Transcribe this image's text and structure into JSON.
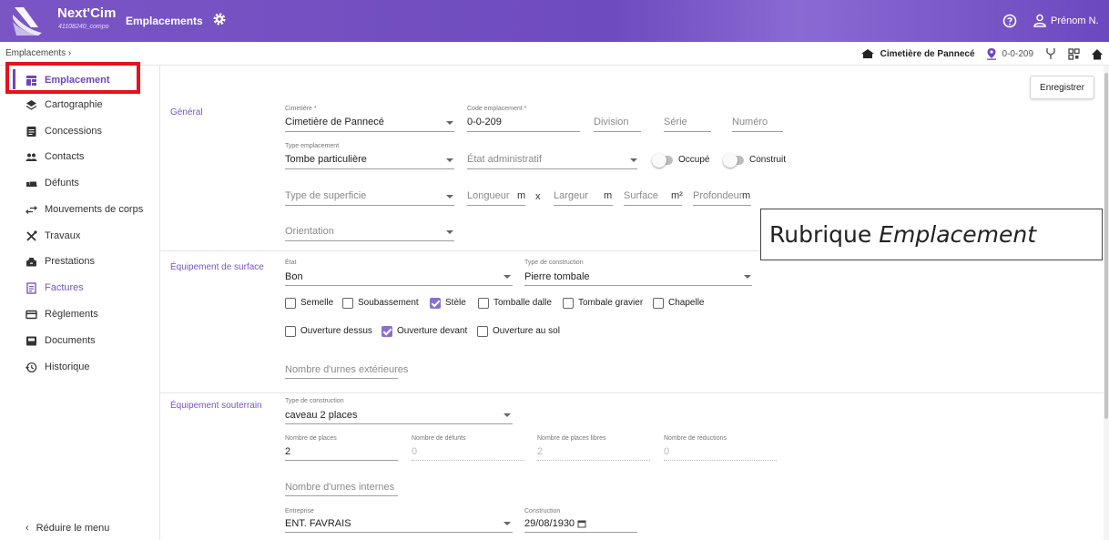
{
  "app": {
    "brand": "Next'Cim",
    "brand_sub": "41108240_compo",
    "module": "Emplacements",
    "user": "Prénom N.",
    "accent_color": "#6b47bd"
  },
  "breadcrumb": {
    "path": "Emplacements  ›",
    "cemetery": "Cimetière de Pannecé",
    "location_code": "0-0-209"
  },
  "sidebar": {
    "items": [
      {
        "label": "Emplacement",
        "icon": "grid-icon"
      },
      {
        "label": "Cartographie",
        "icon": "layers-icon"
      },
      {
        "label": "Concessions",
        "icon": "document-icon"
      },
      {
        "label": "Contacts",
        "icon": "people-icon"
      },
      {
        "label": "Défunts",
        "icon": "bed-icon"
      },
      {
        "label": "Mouvements de corps",
        "icon": "swap-icon"
      },
      {
        "label": "Travaux",
        "icon": "tools-icon"
      },
      {
        "label": "Prestations",
        "icon": "tray-icon"
      },
      {
        "label": "Factures",
        "icon": "invoice-icon"
      },
      {
        "label": "Règlements",
        "icon": "card-icon"
      },
      {
        "label": "Documents",
        "icon": "file-icon"
      },
      {
        "label": "Historique",
        "icon": "history-icon"
      }
    ],
    "collapse_label": "Réduire le menu"
  },
  "toolbar": {
    "save_label": "Enregistrer"
  },
  "callout": {
    "prefix": "Rubrique ",
    "emphasis": "Emplacement"
  },
  "general": {
    "section": "Général",
    "cemetery_label": "Cimetière *",
    "cemetery_value": "Cimetière de Pannecé",
    "code_label": "Code emplacement *",
    "code_value": "0-0-209",
    "division_ph": "Division",
    "serie_ph": "Série",
    "numero_ph": "Numéro",
    "type_label": "Type emplacement",
    "type_value": "Tombe particulière",
    "etat_admin_ph": "État administratif",
    "occupe_label": "Occupé",
    "construit_label": "Construit",
    "superficie_ph": "Type de superficie",
    "longueur_ph": "Longueur",
    "largeur_ph": "Largeur",
    "surface_ph": "Surface",
    "profondeur_ph": "Profondeur",
    "unit_m": "m",
    "unit_x": "x",
    "unit_m2": "m²",
    "orientation_ph": "Orientation"
  },
  "surface": {
    "section": "Équipement de surface",
    "etat_label": "État",
    "etat_value": "Bon",
    "construction_label": "Type de construction",
    "construction_value": "Pierre tombale",
    "checkboxes_row1": [
      {
        "label": "Semelle",
        "checked": false
      },
      {
        "label": "Soubassement",
        "checked": false
      },
      {
        "label": "Stèle",
        "checked": true
      },
      {
        "label": "Tomballe dalle",
        "checked": false
      },
      {
        "label": "Tombale gravier",
        "checked": false
      },
      {
        "label": "Chapelle",
        "checked": false
      }
    ],
    "checkboxes_row2": [
      {
        "label": "Ouverture dessus",
        "checked": false
      },
      {
        "label": "Ouverture devant",
        "checked": true
      },
      {
        "label": "Ouverture au sol",
        "checked": false
      }
    ],
    "urnes_ph": "Nombre d'urnes extérieures"
  },
  "underground": {
    "section": "Équipement souterrain",
    "construction_label": "Type de construction",
    "construction_value": "caveau 2 places",
    "places_label": "Nombre de places",
    "places_value": "2",
    "defunts_label": "Nombre de défunts",
    "defunts_value": "0",
    "libres_label": "Nombre de places libres",
    "libres_value": "2",
    "reductions_label": "Nombre de réductions",
    "reductions_value": "0",
    "urnes_internes_ph": "Nombre d'urnes internes",
    "entreprise_label": "Entreprise",
    "entreprise_value": "ENT. FAVRAIS",
    "construction_date_label": "Construction",
    "construction_date_value": "29/08/1930"
  }
}
